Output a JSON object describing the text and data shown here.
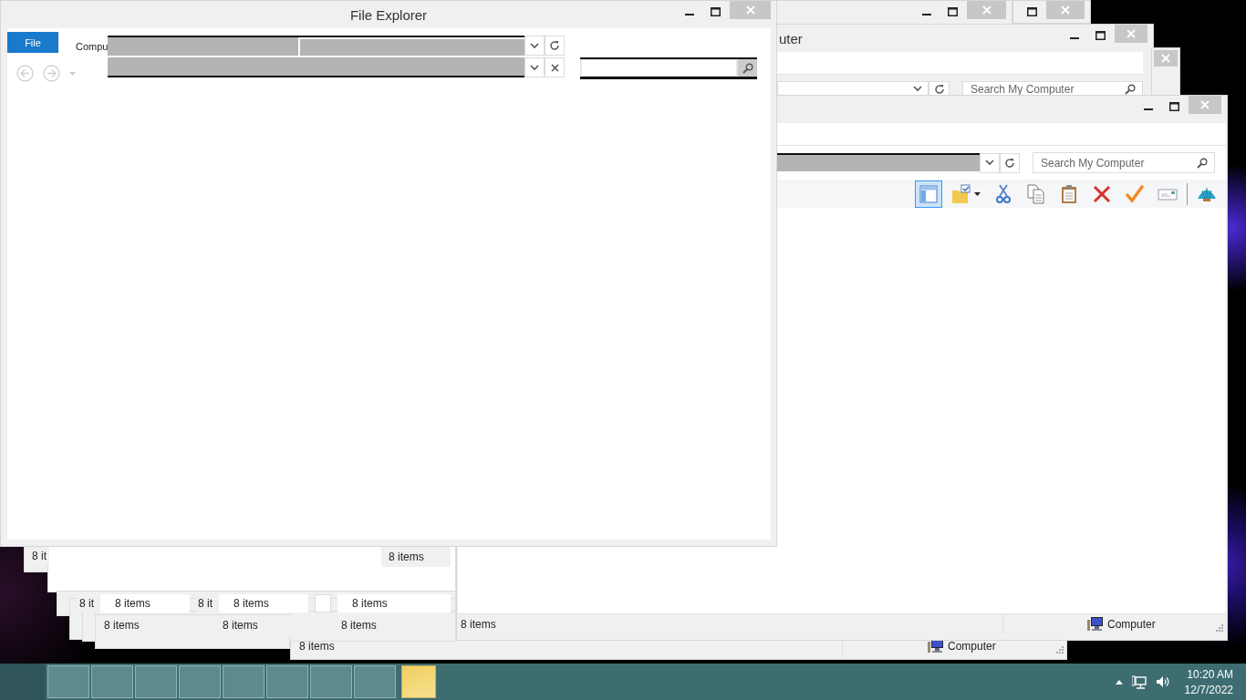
{
  "computer_window": {
    "title": "uter",
    "search": {
      "placeholder": "Search My Computer"
    }
  },
  "bottom_window": {
    "status": "8 items",
    "location": "Computer"
  },
  "cascade": [
    {
      "status": "8 it"
    },
    {
      "status": "8 items"
    },
    {
      "status": "8 it"
    },
    {
      "status": "8 items"
    },
    {
      "status": "8 it"
    },
    {
      "status": "8 items"
    },
    {
      "status": "8 items"
    },
    {
      "status": "8 items"
    },
    {
      "status": "8 items"
    },
    {
      "status": "8 items"
    }
  ],
  "front_computer_window": {
    "search": {
      "placeholder": "Search My Computer"
    },
    "toolbar": [
      {
        "kind": "panes",
        "selected": true
      },
      {
        "kind": "folder",
        "selected": false
      },
      {
        "kind": "cut",
        "selected": false
      },
      {
        "kind": "copy",
        "selected": false
      },
      {
        "kind": "paste",
        "selected": false
      },
      {
        "kind": "delete",
        "selected": false
      },
      {
        "kind": "check",
        "selected": false
      },
      {
        "kind": "card",
        "selected": false
      },
      {
        "kind": "shell",
        "selected": false
      }
    ],
    "status": "8 items",
    "location": "Computer"
  },
  "main_window": {
    "title": "File Explorer",
    "tabs": [
      {
        "label": "File",
        "selected": true
      },
      {
        "label": "Compu",
        "selected": false
      }
    ]
  },
  "taskbar": {
    "buttons": [
      {
        "selected": false
      },
      {
        "selected": false
      },
      {
        "selected": false
      },
      {
        "selected": false
      },
      {
        "selected": false
      },
      {
        "selected": false
      },
      {
        "selected": false
      },
      {
        "selected": false
      },
      {
        "selected": true
      }
    ],
    "clock": {
      "time": "10:20 AM",
      "date": "12/7/2022"
    }
  }
}
